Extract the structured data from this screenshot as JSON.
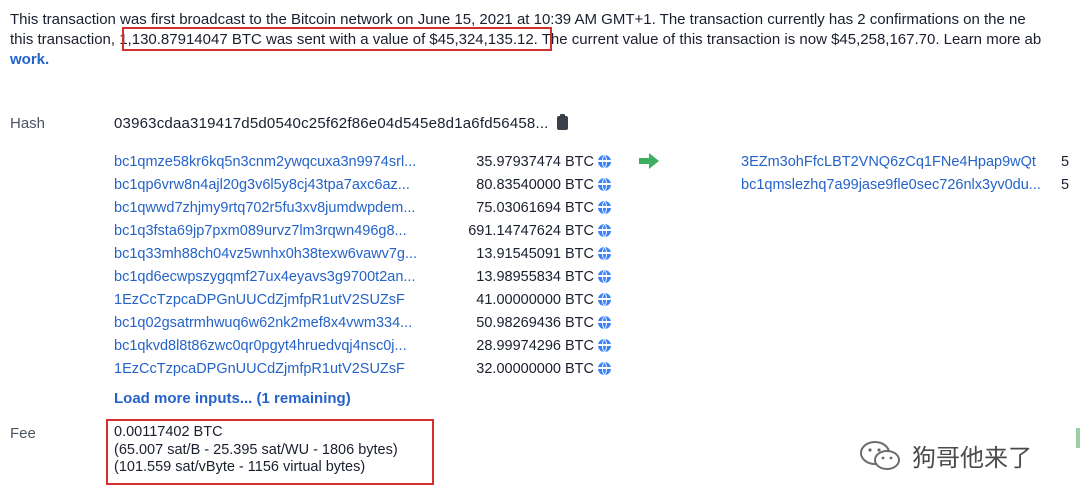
{
  "summary": {
    "line1": "This transaction was first broadcast to the Bitcoin network on June 15, 2021 at 10:39 AM GMT+1.  The transaction currently has 2 confirmations on the ne",
    "line2_pre": "this transaction, ",
    "line2_highlight": "1,130.87914047 BTC was sent with a value of $45,324,135.12.",
    "line2_post": " The current value of this transaction is now $45,258,167.70.  Learn more ab",
    "line3_link": "work."
  },
  "hash": {
    "label": "Hash",
    "value": "03963cdaa319417d5d0540c25f62f86e04d545e8d1a6fd56458..."
  },
  "inputs": [
    {
      "address": "bc1qmze58kr6kq5n3cnm2ywqcuxa3n9974srl...",
      "amount": "35.97937474 BTC"
    },
    {
      "address": "bc1qp6vrw8n4ajl20g3v6l5y8cj43tpa7axc6az...",
      "amount": "80.83540000 BTC"
    },
    {
      "address": "bc1qwwd7zhjmy9rtq702r5fu3xv8jumdwpdem...",
      "amount": "75.03061694 BTC"
    },
    {
      "address": "bc1q3fsta69jp7pxm089urvz7lm3rqwn496g8...",
      "amount": "691.14747624 BTC"
    },
    {
      "address": "bc1q33mh88ch04vz5wnhx0h38texw6vawv7g...",
      "amount": "13.91545091 BTC"
    },
    {
      "address": "bc1qd6ecwpszygqmf27ux4eyavs3g9700t2an...",
      "amount": "13.98955834 BTC"
    },
    {
      "address": "1EzCcTzpcaDPGnUUCdZjmfpR1utV2SUZsF",
      "amount": "41.00000000 BTC"
    },
    {
      "address": "bc1q02gsatrmhwuq6w62nk2mef8x4vwm334...",
      "amount": "50.98269436 BTC"
    },
    {
      "address": "bc1qkvd8l8t86zwc0qr0pgyt4hruedvqj4nsc0j...",
      "amount": "28.99974296 BTC"
    },
    {
      "address": "1EzCcTzpcaDPGnUUCdZjmfpR1utV2SUZsF",
      "amount": "32.00000000 BTC"
    }
  ],
  "outputs": [
    {
      "address": "3EZm3ohFfcLBT2VNQ6zCq1FNe4Hpap9wQt",
      "amount": "5"
    },
    {
      "address": "bc1qmslezhq7a99jase9fle0sec726nlx3yv0du...",
      "amount": "5"
    }
  ],
  "load_more": "Load more inputs... (1 remaining)",
  "fee": {
    "label": "Fee",
    "btc": "0.00117402 BTC",
    "rate1": "(65.007 sat/B - 25.395 sat/WU - 1806 bytes)",
    "rate2": "(101.559 sat/vByte - 1156 virtual bytes)"
  },
  "watermark": "狗哥他来了",
  "colors": {
    "link": "#2563c9",
    "highlight_border": "#d2312b",
    "arrow": "#3fae62"
  },
  "icons": {
    "copy": "clipboard-icon",
    "globe": "globe-icon",
    "arrow": "arrow-right-icon"
  }
}
